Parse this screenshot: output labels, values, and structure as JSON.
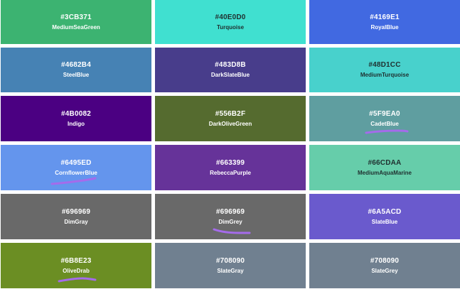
{
  "swatches": [
    {
      "hex": "#3CB371",
      "name": "MediumSeaGreen",
      "bg": "#3CB371",
      "text": "light"
    },
    {
      "hex": "#40E0D0",
      "name": "Turquoise",
      "bg": "#40E0D0",
      "text": "dark"
    },
    {
      "hex": "#4169E1",
      "name": "RoyalBlue",
      "bg": "#4169E1",
      "text": "light"
    },
    {
      "hex": "#4682B4",
      "name": "SteelBlue",
      "bg": "#4682B4",
      "text": "light"
    },
    {
      "hex": "#483D8B",
      "name": "DarkSlateBlue",
      "bg": "#483D8B",
      "text": "light"
    },
    {
      "hex": "#48D1CC",
      "name": "MediumTurquoise",
      "bg": "#48D1CC",
      "text": "dark"
    },
    {
      "hex": "#4B0082",
      "name": "Indigo",
      "bg": "#4B0082",
      "text": "light"
    },
    {
      "hex": "#556B2F",
      "name": "DarkOliveGreen",
      "bg": "#556B2F",
      "text": "light"
    },
    {
      "hex": "#5F9EA0",
      "name": "CadetBlue",
      "bg": "#5F9EA0",
      "text": "light"
    },
    {
      "hex": "#6495ED",
      "name": "CornflowerBlue",
      "bg": "#6495ED",
      "text": "light"
    },
    {
      "hex": "#663399",
      "name": "RebeccaPurple",
      "bg": "#663399",
      "text": "light"
    },
    {
      "hex": "#66CDAA",
      "name": "MediumAquaMarine",
      "bg": "#66CDAA",
      "text": "dark"
    },
    {
      "hex": "#696969",
      "name": "DimGray",
      "bg": "#696969",
      "text": "light"
    },
    {
      "hex": "#696969",
      "name": "DimGrey",
      "bg": "#696969",
      "text": "light"
    },
    {
      "hex": "#6A5ACD",
      "name": "SlateBlue",
      "bg": "#6A5ACD",
      "text": "light"
    },
    {
      "hex": "#6B8E23",
      "name": "OliveDrab",
      "bg": "#6B8E23",
      "text": "light"
    },
    {
      "hex": "#708090",
      "name": "SlateGray",
      "bg": "#708090",
      "text": "light"
    },
    {
      "hex": "#708090",
      "name": "SlateGrey",
      "bg": "#708090",
      "text": "light"
    }
  ],
  "annotation_color": "#A56BEB"
}
